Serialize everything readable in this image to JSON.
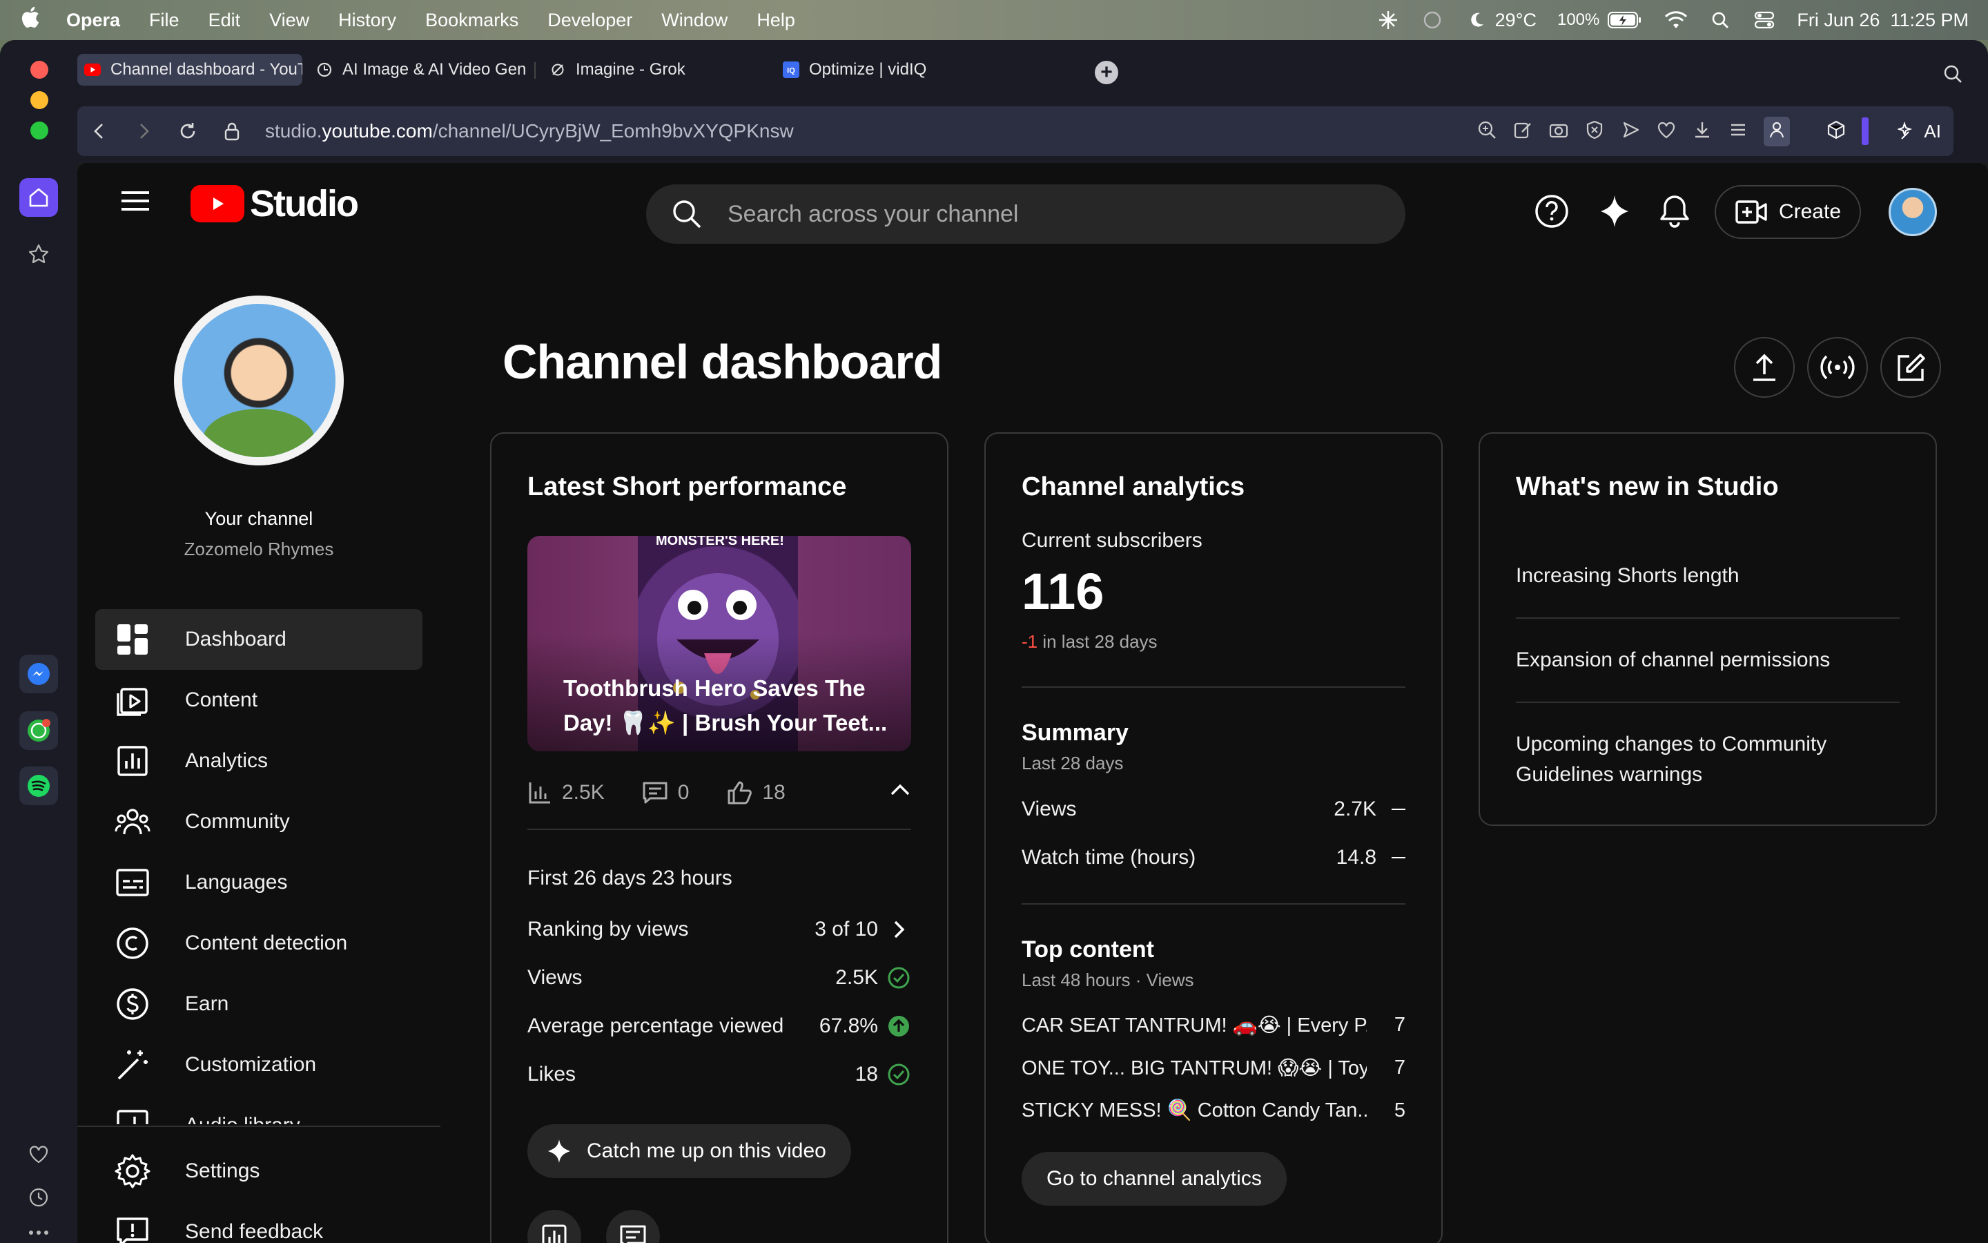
{
  "menubar": {
    "app": "Opera",
    "items": [
      "File",
      "Edit",
      "View",
      "History",
      "Bookmarks",
      "Developer",
      "Window",
      "Help"
    ],
    "temperature": "29°C",
    "battery": "100%",
    "datetime": "Fri Jun 26  11:25 PM"
  },
  "tabs": [
    {
      "label": "Channel dashboard - YouTube Studio",
      "icon": "youtube-icon"
    },
    {
      "label": "AI Image & AI Video Gen",
      "icon": "globe-icon"
    },
    {
      "label": "Imagine - Grok",
      "icon": "grok-icon"
    },
    {
      "label": "Optimize | vidIQ",
      "icon": "vidiq-icon"
    }
  ],
  "address": {
    "url_host": "studio.youtube.com",
    "url_prefix": "studio.",
    "url_domain": "youtube.com",
    "url_path": "/channel/UCyryBjW_Eomh9bvXYQPKnsw",
    "ai_label": "AI"
  },
  "studio": {
    "logo_text": "Studio",
    "search_placeholder": "Search across your channel",
    "create_label": "Create"
  },
  "channel": {
    "title": "Your channel",
    "name": "Zozomelo Rhymes"
  },
  "nav": [
    {
      "label": "Dashboard",
      "icon": "dashboard-icon",
      "active": true
    },
    {
      "label": "Content",
      "icon": "content-icon"
    },
    {
      "label": "Analytics",
      "icon": "analytics-icon"
    },
    {
      "label": "Community",
      "icon": "community-icon"
    },
    {
      "label": "Languages",
      "icon": "subtitles-icon"
    },
    {
      "label": "Content detection",
      "icon": "copyright-icon"
    },
    {
      "label": "Earn",
      "icon": "dollar-icon"
    },
    {
      "label": "Customization",
      "icon": "magic-wand-icon"
    },
    {
      "label": "Audio library",
      "icon": "audio-library-icon"
    }
  ],
  "nav_bottom": [
    {
      "label": "Settings",
      "icon": "gear-icon"
    },
    {
      "label": "Send feedback",
      "icon": "feedback-icon"
    }
  ],
  "page": {
    "title": "Channel dashboard"
  },
  "latest_short": {
    "card_title": "Latest Short performance",
    "thumb_banner": "MONSTER'S HERE!",
    "video_title": "Toothbrush Hero Saves The Day! 🦷✨ | Brush Your Teet...",
    "views": "2.5K",
    "comments": "0",
    "likes": "18",
    "period": "First 26 days 23 hours",
    "metrics": [
      {
        "label": "Ranking by views",
        "value": "3 of 10",
        "end": "chevron"
      },
      {
        "label": "Views",
        "value": "2.5K",
        "end": "check"
      },
      {
        "label": "Average percentage viewed",
        "value": "67.8%",
        "end": "up"
      },
      {
        "label": "Likes",
        "value": "18",
        "end": "check"
      }
    ],
    "catch_up_label": "Catch me up on this video"
  },
  "analytics": {
    "card_title": "Channel analytics",
    "subs_label": "Current subscribers",
    "subs_value": "116",
    "subs_delta": "-1",
    "subs_delta_suffix": " in last 28 days",
    "summary_title": "Summary",
    "summary_sub": "Last 28 days",
    "summary": [
      {
        "label": "Views",
        "value": "2.7K"
      },
      {
        "label": "Watch time (hours)",
        "value": "14.8"
      }
    ],
    "top_title": "Top content",
    "top_sub": "Last 48 hours · Views",
    "top_items": [
      {
        "title": "CAR SEAT TANTRUM! 🚗😭 | Every P...",
        "views": "7"
      },
      {
        "title": "ONE TOY... BIG TANTRUM! 😱😭 | Toy...",
        "views": "7"
      },
      {
        "title": "STICKY MESS! 🍭 Cotton Candy Tan...",
        "views": "5"
      }
    ],
    "go_label": "Go to channel analytics"
  },
  "news": {
    "card_title": "What's new in Studio",
    "items": [
      "Increasing Shorts length",
      "Expansion of channel permissions",
      "Upcoming changes to Community Guidelines warnings"
    ]
  },
  "colors": {
    "accent_red": "#ff0000",
    "opera_purple": "#6a4cf0",
    "check_green": "#3fa34d",
    "delta_red": "#ff4e45"
  }
}
